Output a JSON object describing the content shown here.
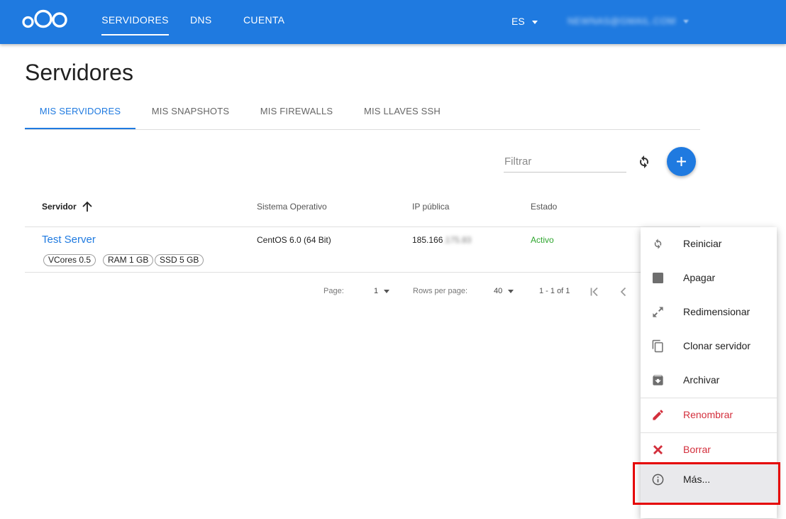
{
  "header": {
    "nav": [
      "SERVIDORES",
      "DNS",
      "CUENTA"
    ],
    "language": "ES",
    "account_email": "NEWNAS@GMAIL.COM"
  },
  "page": {
    "title": "Servidores"
  },
  "tabs": [
    "MIS SERVIDORES",
    "MIS SNAPSHOTS",
    "MIS FIREWALLS",
    "MIS LLAVES SSH"
  ],
  "toolbar": {
    "filter_placeholder": "Filtrar"
  },
  "table": {
    "headers": [
      "Servidor",
      "Sistema Operativo",
      "IP pública",
      "Estado"
    ],
    "rows": [
      {
        "name": "Test Server",
        "chips": [
          "VCores 0.5",
          "RAM 1 GB",
          "SSD 5 GB"
        ],
        "os": "CentOS 6.0 (64 Bit)",
        "ip_visible": "185.166",
        "ip_hidden": ".175.83",
        "status": "Activo"
      }
    ]
  },
  "pagination": {
    "page_label": "Page:",
    "page_value": "1",
    "rows_label": "Rows per page:",
    "rows_value": "40",
    "range": "1 - 1 of 1"
  },
  "menu": {
    "items": [
      {
        "label": "Reiniciar",
        "icon": "restart-icon"
      },
      {
        "label": "Apagar",
        "icon": "stop-icon"
      },
      {
        "label": "Redimensionar",
        "icon": "resize-icon"
      },
      {
        "label": "Clonar servidor",
        "icon": "copy-icon"
      },
      {
        "label": "Archivar",
        "icon": "archive-icon"
      },
      {
        "label": "Renombrar",
        "icon": "pencil-icon"
      },
      {
        "label": "Borrar",
        "icon": "delete-x-icon"
      },
      {
        "label": "Más...",
        "icon": "info-icon"
      }
    ]
  },
  "colors": {
    "brand": "#1f7ae0",
    "status_active": "#2ea52e",
    "danger": "#d32f3c",
    "highlight_box": "#e50000"
  }
}
